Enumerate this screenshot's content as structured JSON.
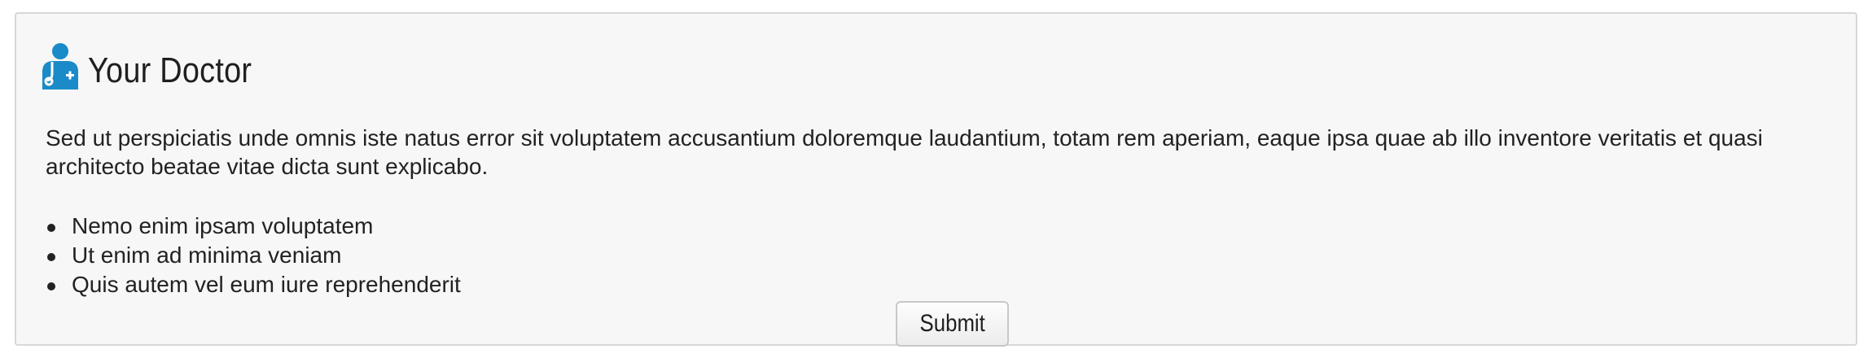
{
  "header": {
    "icon": "doctor-icon",
    "title": "Your Doctor",
    "accent_color": "#1a8ac8"
  },
  "content": {
    "description": "Sed ut perspiciatis unde omnis iste natus error sit voluptatem accusantium doloremque laudantium, totam rem aperiam, eaque ipsa quae ab illo inventore veritatis et quasi architecto beatae vitae dicta sunt explicabo.",
    "items": [
      "Nemo enim ipsam voluptatem",
      "Ut enim ad minima veniam",
      "Quis autem vel eum iure reprehenderit"
    ]
  },
  "actions": {
    "submit_label": "Submit"
  }
}
